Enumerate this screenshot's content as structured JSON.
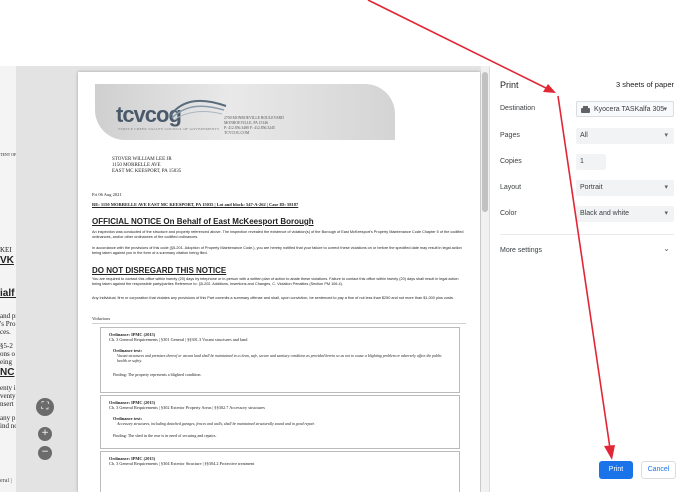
{
  "background_page": {
    "fragments": [
      "VK",
      "TENT OF",
      "KEI",
      "ialf o",
      "and pr",
      "'s Pro",
      "ces.",
      "§5-2",
      "ons o",
      "eing",
      "NC",
      "enty i",
      "venty",
      "nsert",
      "any p",
      "ind no"
    ],
    "status_text": "eral |"
  },
  "letter": {
    "logo_text": "tcvcog",
    "logo_tagline": "TURTLE CREEK VALLEY COUNCIL OF GOVERNMENTS",
    "org_address": [
      "2700 MONROEVILLE BOULEVARD",
      "MONROEVILLE, PA 15146",
      "P: 412.856.3480 F: 412.856.3245",
      "TCVCOG.COM"
    ],
    "recipient": [
      "STOVER WILLIAM LEE JR",
      "1150 MORRELLE AVE",
      "EAST MC KEESPORT, PA 15035"
    ],
    "date": "Fri 06 Aug 2021",
    "re_line": "RE: 1150 MORRELLE AVE EAST MC KEESPORT, PA 15035 | Lot and block: 547-A-262 | Case ID: 58187",
    "heading1": "OFFICIAL NOTICE On Behalf of East McKeesport Borough",
    "para1": "An inspection was conducted of the structure and property referenced above. The inspection revealed the existence of violation(s) of the Borough of East McKeesport's Property Maintenance Code Chapter 5 of the codified ordinances, and/or other ordinances of the codified ordinances.",
    "para2": "In accordance with the provisions of this code (§5-201. Adoption of Property Maintenance Code.), you are hereby notified that your failure to correct these violations on or before the specified date may result in legal action being taken against you in the form of a summary citation being filed.",
    "heading2": "DO NOT DISREGARD THIS NOTICE",
    "para3": "You are required to contact this office within twenty (20) days by telephone or in-person with a written plan of action to abate these violations. Failure to contact this office within twenty (20) days shall result in legal action being taken against the responsible party/parties Reference to: §5-202. Additions, Insertions and Changes, C. Violation Penalties (Section PM 106.4).",
    "para4": "Any individual, firm or corporation that violates any provisions of this Part commits a summary offense and shall, upon conviction, be sentenced to pay a fine of not less than $250 and not more than $1,000 plus costs.",
    "violations_label": "Violations",
    "violations": [
      {
        "ordinance": "Ordinance: IPMC (2015)",
        "chapter": "Ch. 3 General Requirements | §301 General | §§301.3 Vacant structures and land",
        "text_label": "Ordinance text:",
        "text": "Vacant structures and premises thereof or vacant land shall be maintained in a clean, safe, secure and sanitary condition as provided herein so as not to cause a blighting problem or adversely affect the public health or safety.",
        "finding": "Finding: The property represents a blighted condition."
      },
      {
        "ordinance": "Ordinance: IPMC (2015)",
        "chapter": "Ch. 3 General Requirements | §302 Exterior Property Areas | §§302.7 Accessory structures",
        "text_label": "Ordinance text:",
        "text": "Accessory structures, including detached garages, fences and walls, shall be maintained structurally sound and in good repair.",
        "finding": "Finding: The shed in the rear is in need of securing and repairs."
      },
      {
        "ordinance": "Ordinance: IPMC (2015)",
        "chapter": "Ch. 3 General Requirements | §304 Exterior Structure | §§304.2 Protective treatment"
      }
    ]
  },
  "zoom_controls": {
    "fit": "⛶",
    "zoom_in": "+",
    "zoom_out": "−"
  },
  "print_panel": {
    "title": "Print",
    "sheets": "3 sheets of paper",
    "destination_label": "Destination",
    "destination_value": "Kyocera TASKalfa 305",
    "pages_label": "Pages",
    "pages_value": "All",
    "copies_label": "Copies",
    "copies_value": "1",
    "layout_label": "Layout",
    "layout_value": "Portrait",
    "color_label": "Color",
    "color_value": "Black and white",
    "more_settings": "More settings",
    "print_button": "Print",
    "cancel_button": "Cancel"
  },
  "colors": {
    "accent": "#1a73e8",
    "arrow": "#e32636"
  },
  "icons": [
    "printer-icon",
    "chevron-down-icon",
    "fit-page-icon",
    "zoom-in-icon",
    "zoom-out-icon"
  ]
}
